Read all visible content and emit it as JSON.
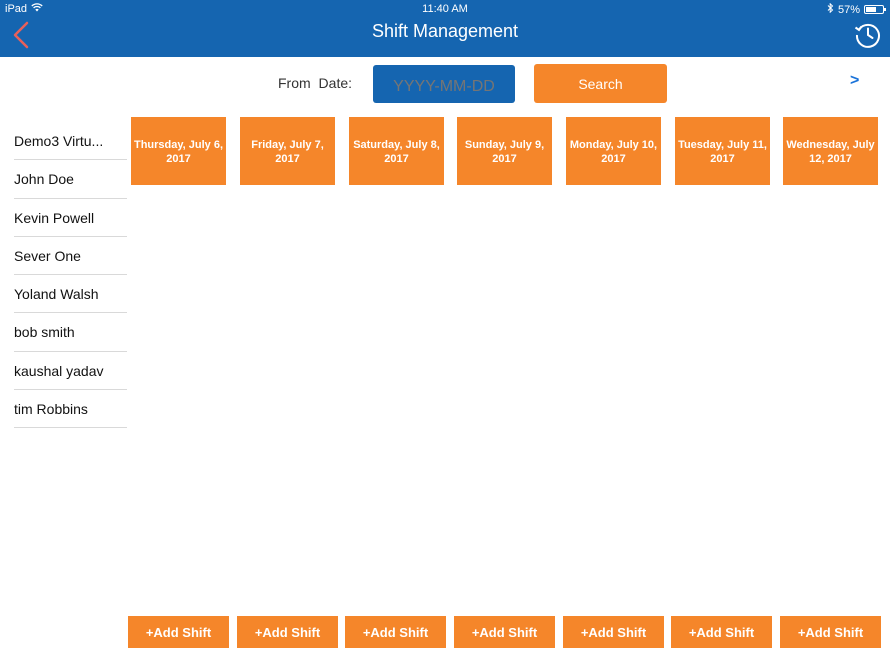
{
  "status_bar": {
    "device": "iPad",
    "time": "11:40 AM",
    "battery": "57%",
    "battery_level": 0.57,
    "icons": [
      "wifi-icon",
      "bluetooth-icon",
      "battery-icon"
    ]
  },
  "header": {
    "title": "Shift Management",
    "back_icon": "chevron-left-icon",
    "history_icon": "clock-history-icon"
  },
  "search": {
    "from_label": "From Date:",
    "date_placeholder": "YYYY-MM-DD",
    "search_label": "Search",
    "next_label": ">"
  },
  "employees": [
    "Demo3 Virtu...",
    "John Doe",
    "Kevin Powell",
    "Sever One",
    "Yoland Walsh",
    "bob smith",
    "kaushal yadav",
    "tim Robbins"
  ],
  "days": [
    "Thursday, July 6, 2017",
    "Friday, July 7, 2017",
    "Saturday, July 8, 2017",
    "Sunday, July 9, 2017",
    "Monday, July 10, 2017",
    "Tuesday, July 11, 2017",
    "Wednesday, July 12, 2017"
  ],
  "add_shift_label": "+Add Shift",
  "colors": {
    "primary_blue": "#1565b0",
    "accent_orange": "#f5862a",
    "link_blue": "#1a73d9",
    "back_arrow": "#e8605a"
  }
}
